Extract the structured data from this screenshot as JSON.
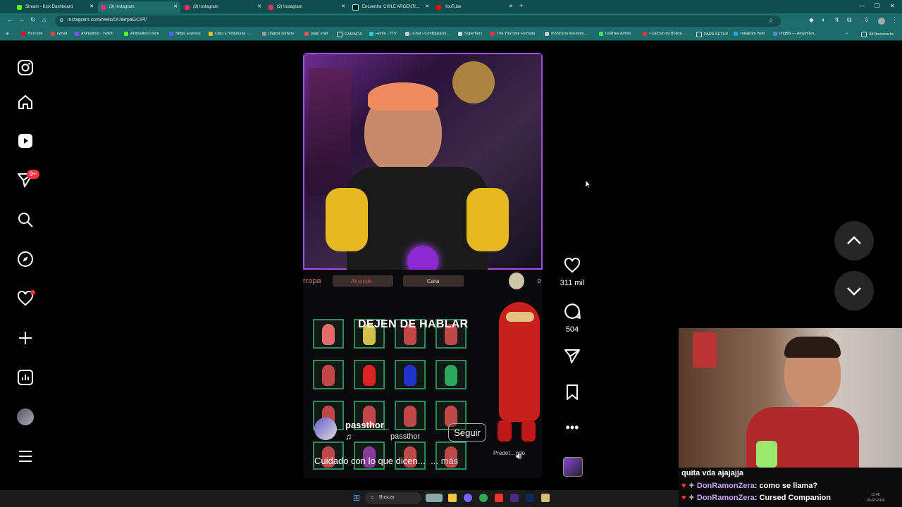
{
  "browser": {
    "tabs": [
      {
        "title": "Stream - Kick Dashboard",
        "color": "#53fc18",
        "active": false
      },
      {
        "title": "(9) Instagram",
        "color": "#e1306c",
        "active": true
      },
      {
        "title": "(9) Instagram",
        "color": "#e1306c",
        "active": false
      },
      {
        "title": "(9) Instagram",
        "color": "#e1306c",
        "active": false
      },
      {
        "title": "Encuentra 'CHILE ARGENTI…",
        "color": "#000000",
        "active": false
      },
      {
        "title": "YouTube",
        "color": "#ff0000",
        "active": false
      }
    ],
    "new_tab": "+",
    "url": "instagram.com/reels/DUWrpaGCIPl/",
    "bookmarks": [
      "YouTube",
      "Gmail",
      "Animalitoo - Twitch",
      "Animalitoo | Kick",
      "Stripe Express",
      "Clips y miniaturas -…",
      "página sorteos",
      "pago enel",
      "CASINOS",
      "Home - 7TV",
      "¡Chat • Configuració…",
      "Superfans",
      "The YouTube Formula",
      "mohicano-low-fade…",
      "Linktree Admin",
      "• Calculo de Boleta…",
      "PARA SETUP",
      "Telegram Web",
      "ImgBB — Alojamien…"
    ],
    "all_bookmarks": "All Bookmarks"
  },
  "sidebar": {
    "notifications_badge": "9+"
  },
  "reel": {
    "hud": {
      "left": "rropa",
      "mid1": "Atuendo",
      "mid2": "Cara",
      "count": "0"
    },
    "overlay_text": "DEJEN DE HABLAR",
    "username": "passthor_",
    "username_ingame": "passthor",
    "follow_label": "Seguir",
    "caption": "Cuidado con lo que dicen...",
    "more_label": "... más",
    "preset_label": "Predet…ndo",
    "likes": "311 mil",
    "comments": "504"
  },
  "chat": [
    {
      "user": "",
      "text": "quita vda ajajajja"
    },
    {
      "user": "DonRamonZera",
      "text": "como se llama?"
    },
    {
      "user": "DonRamonZera",
      "text": "Cursed Companion"
    }
  ],
  "taskbar": {
    "search_placeholder": "Buscar",
    "time": "13:40",
    "date": "05-02-2026"
  }
}
